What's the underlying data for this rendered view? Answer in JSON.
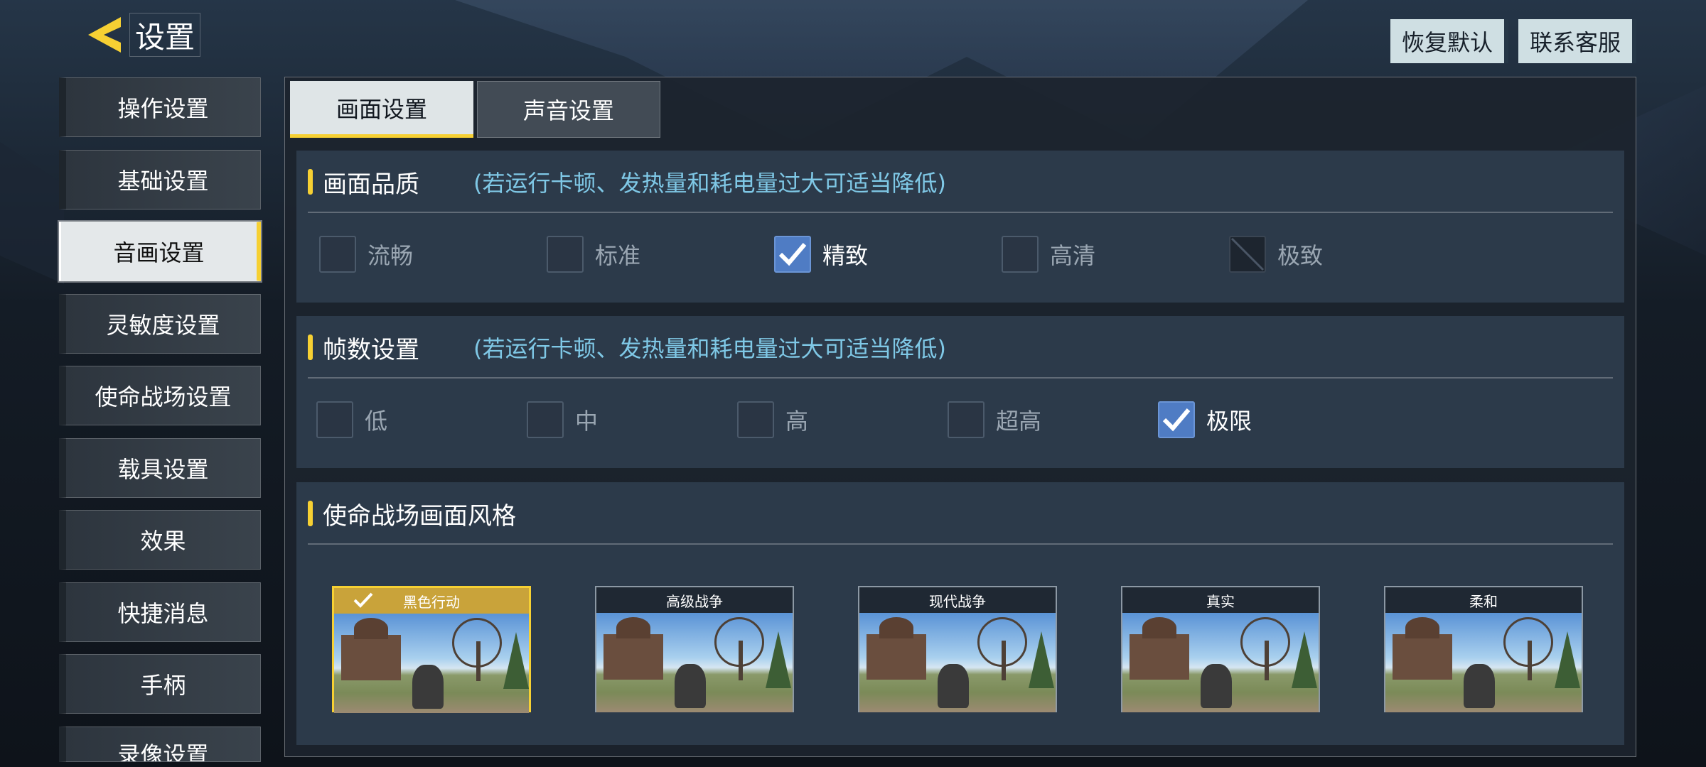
{
  "header": {
    "title": "设置",
    "restore_default": "恢复默认",
    "contact_support": "联系客服"
  },
  "sidebar": {
    "items": [
      {
        "label": "操作设置",
        "active": false
      },
      {
        "label": "基础设置",
        "active": false
      },
      {
        "label": "音画设置",
        "active": true
      },
      {
        "label": "灵敏度设置",
        "active": false
      },
      {
        "label": "使命战场设置",
        "active": false
      },
      {
        "label": "载具设置",
        "active": false
      },
      {
        "label": "效果",
        "active": false
      },
      {
        "label": "快捷消息",
        "active": false
      },
      {
        "label": "手柄",
        "active": false
      },
      {
        "label": "录像设置",
        "active": false
      }
    ]
  },
  "tabs": [
    {
      "label": "画面设置",
      "active": true
    },
    {
      "label": "声音设置",
      "active": false
    }
  ],
  "quality": {
    "title": "画面品质",
    "hint": "(若运行卡顿、发热量和耗电量过大可适当降低)",
    "options": [
      {
        "label": "流畅",
        "state": "unchecked"
      },
      {
        "label": "标准",
        "state": "unchecked"
      },
      {
        "label": "精致",
        "state": "checked"
      },
      {
        "label": "高清",
        "state": "unchecked"
      },
      {
        "label": "极致",
        "state": "disabled"
      }
    ]
  },
  "framerate": {
    "title": "帧数设置",
    "hint": "(若运行卡顿、发热量和耗电量过大可适当降低)",
    "options": [
      {
        "label": "低",
        "state": "unchecked"
      },
      {
        "label": "中",
        "state": "unchecked"
      },
      {
        "label": "高",
        "state": "unchecked"
      },
      {
        "label": "超高",
        "state": "unchecked"
      },
      {
        "label": "极限",
        "state": "checked"
      }
    ]
  },
  "style": {
    "title": "使命战场画面风格",
    "cards": [
      {
        "label": "黑色行动",
        "selected": true
      },
      {
        "label": "高级战争",
        "selected": false
      },
      {
        "label": "现代战争",
        "selected": false
      },
      {
        "label": "真实",
        "selected": false
      },
      {
        "label": "柔和",
        "selected": false
      }
    ]
  },
  "colors": {
    "accent": "#f6d033",
    "checkbox_checked": "#4f7cc4",
    "hint_text": "#7fc8e6"
  }
}
